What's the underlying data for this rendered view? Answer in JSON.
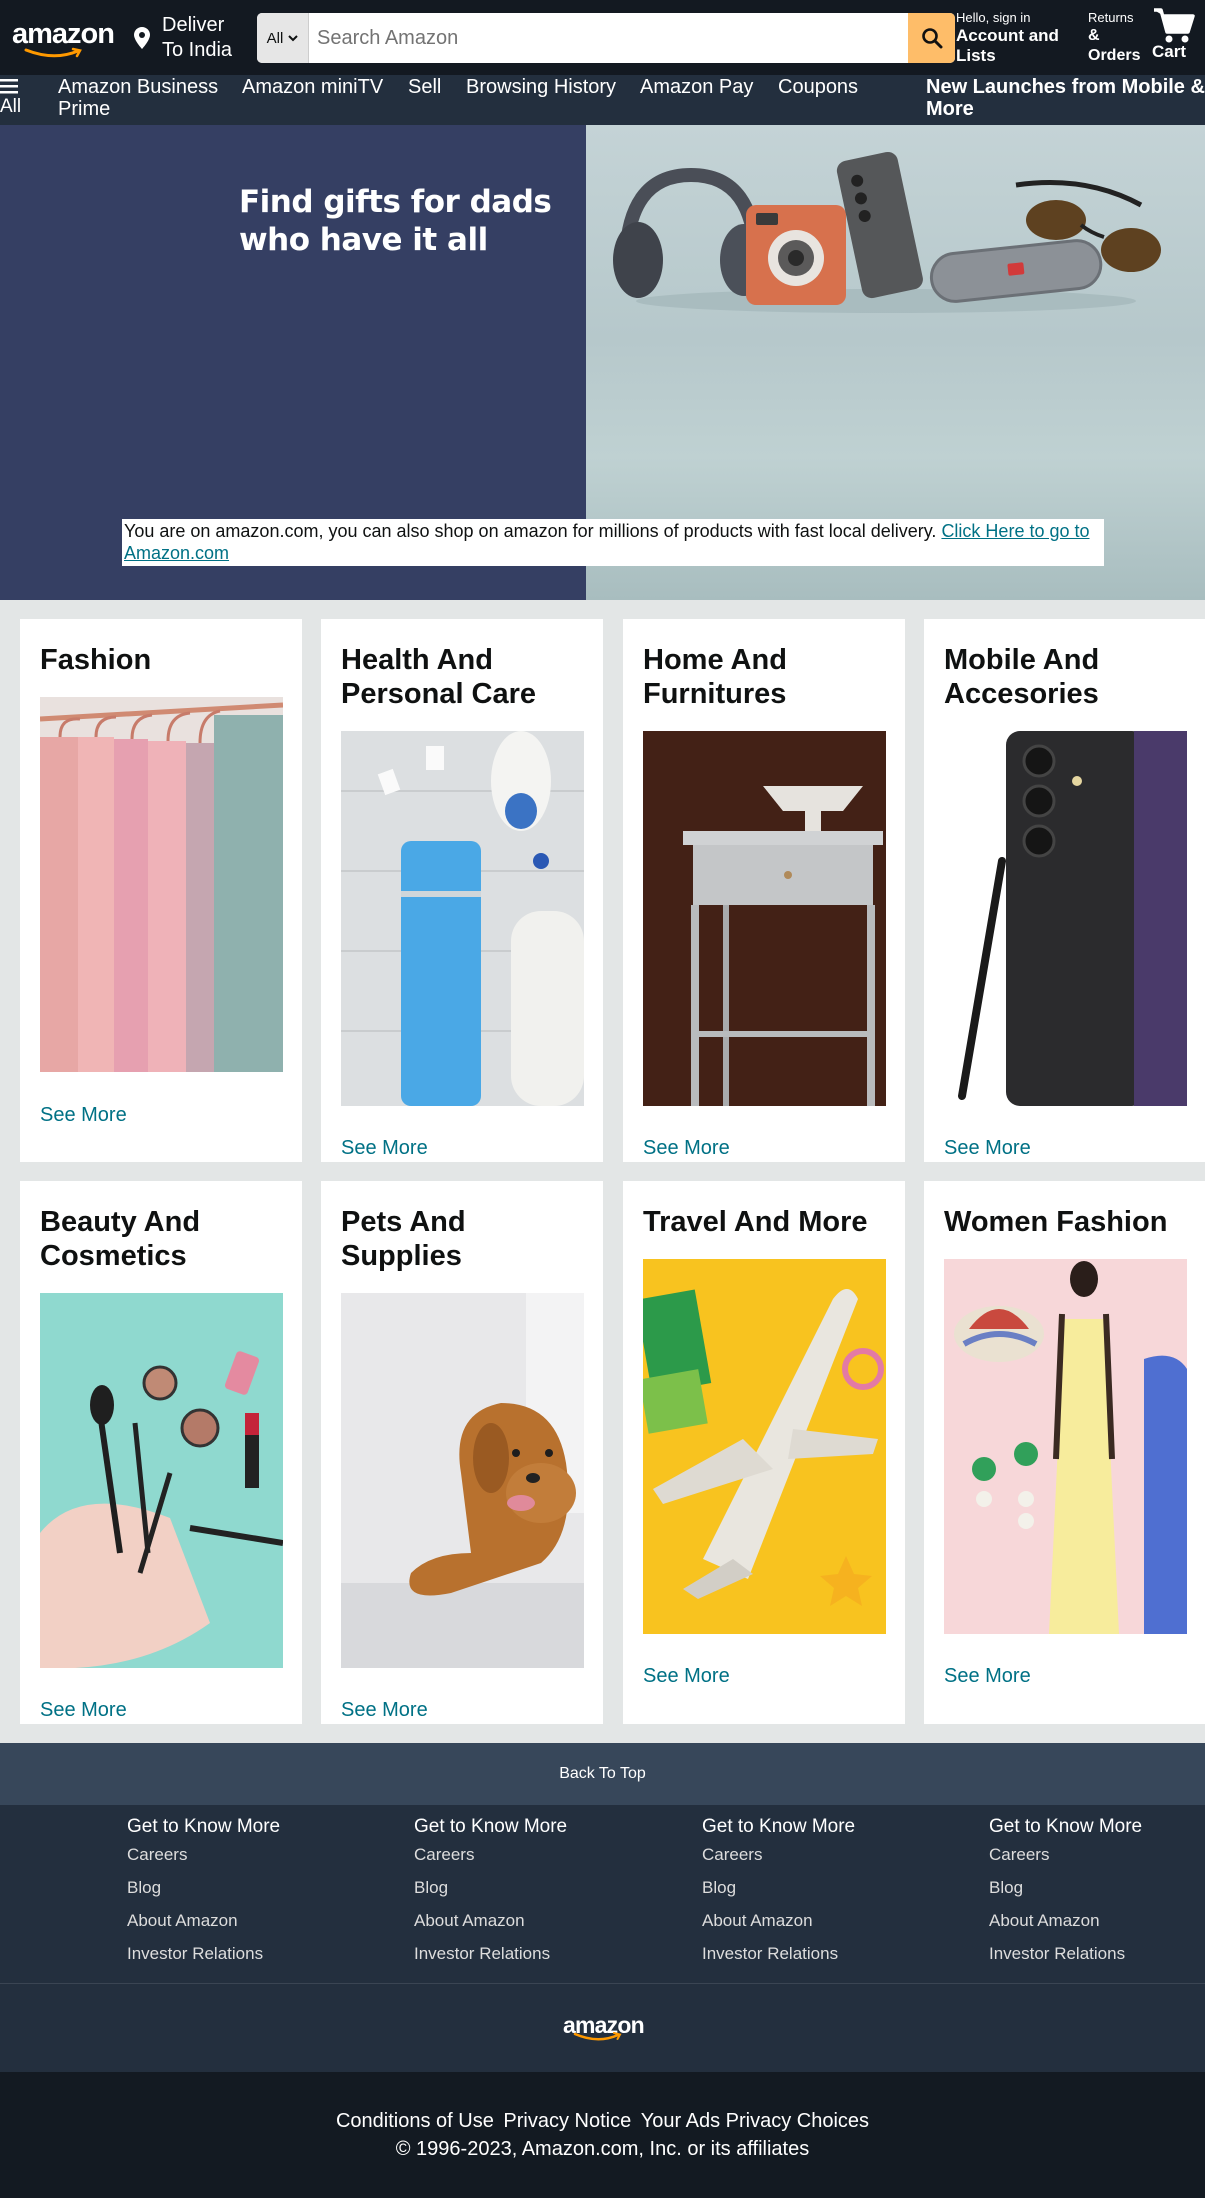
{
  "header": {
    "logo": "amazon",
    "deliver_label": "Deliver To India",
    "search": {
      "category": "All",
      "placeholder": "Search Amazon"
    },
    "account": {
      "greeting": "Hello, sign in",
      "label": "Account and Lists"
    },
    "returns": {
      "top": "Returns",
      "label": "& Orders"
    },
    "cart": {
      "label": "Cart"
    },
    "colors": {
      "header_bg": "#131921",
      "nav_bg": "#232f3e",
      "search_button": "#febd69"
    }
  },
  "nav": {
    "all_label": "All",
    "items": [
      "Amazon Business Prime",
      "Amazon miniTV",
      "Sell",
      "Browsing History",
      "Amazon Pay",
      "Coupons"
    ],
    "promo": "New Launches from Mobile & More"
  },
  "hero": {
    "title": "Find gifts for dads who have it all",
    "notice_text": "You are on amazon.com, you can also shop on amazon for millions of products with fast local delivery. ",
    "notice_link": "Click Here to go to Amazon.com"
  },
  "categories": [
    {
      "title": "Fashion",
      "link": "See More"
    },
    {
      "title": "Health And Personal Care",
      "link": "See More"
    },
    {
      "title": "Home And Furnitures",
      "link": "See More"
    },
    {
      "title": "Mobile And Accesories",
      "link": "See More"
    },
    {
      "title": "Beauty And Cosmetics",
      "link": "See More"
    },
    {
      "title": "Pets And Supplies",
      "link": "See More"
    },
    {
      "title": "Travel And More",
      "link": "See More"
    },
    {
      "title": "Women Fashion",
      "link": "See More"
    }
  ],
  "footer": {
    "back_to_top": "Back To Top",
    "columns": [
      {
        "heading": "Get to Know More",
        "links": [
          "Careers",
          "Blog",
          "About Amazon",
          "Investor Relations"
        ]
      },
      {
        "heading": "Get to Know More",
        "links": [
          "Careers",
          "Blog",
          "About Amazon",
          "Investor Relations"
        ]
      },
      {
        "heading": "Get to Know More",
        "links": [
          "Careers",
          "Blog",
          "About Amazon",
          "Investor Relations"
        ]
      },
      {
        "heading": "Get to Know More",
        "links": [
          "Careers",
          "Blog",
          "About Amazon",
          "Investor Relations"
        ]
      }
    ],
    "logo": "amazon",
    "bottom_links": [
      "Conditions of Use",
      "Privacy Notice",
      "Your Ads Privacy Choices"
    ],
    "copyright": "© 1996-2023, Amazon.com, Inc. or its affiliates"
  }
}
